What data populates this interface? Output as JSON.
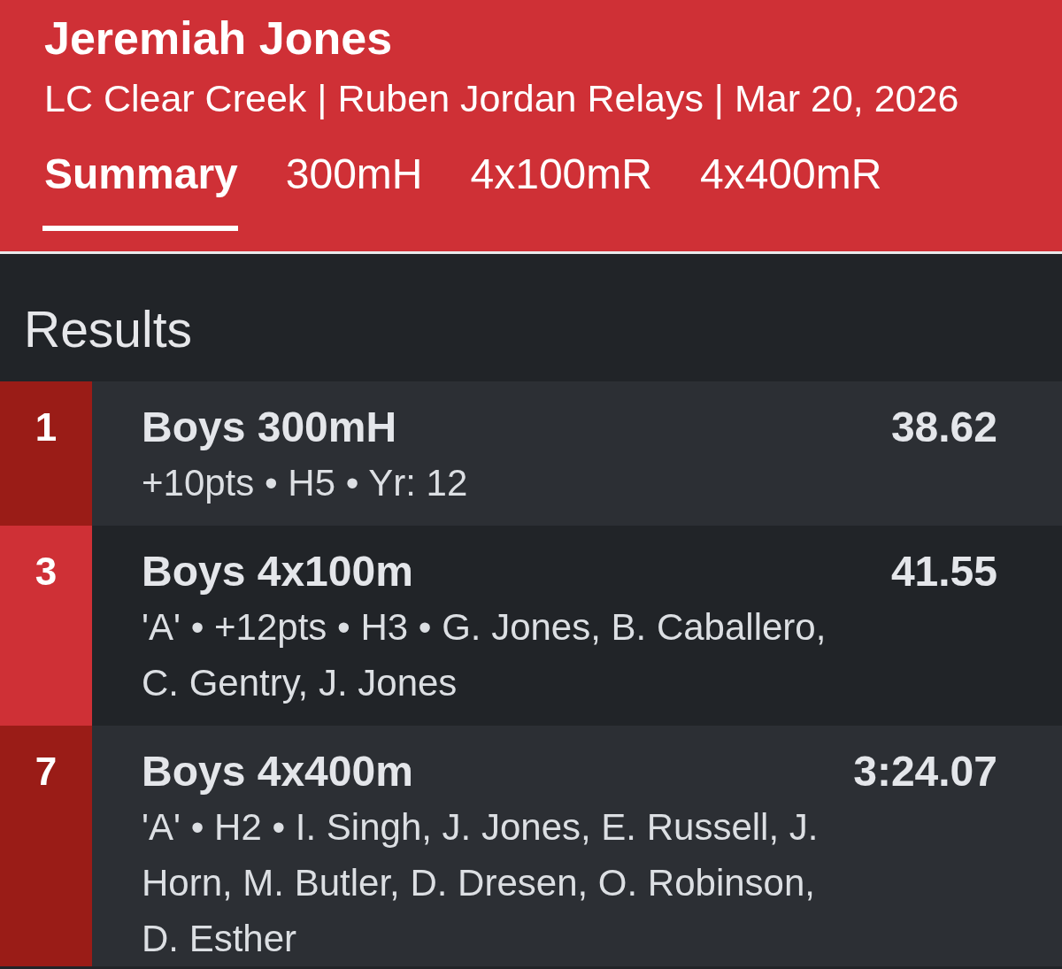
{
  "header": {
    "title": "Jeremiah Jones",
    "subtitle": "LC Clear Creek | Ruben Jordan Relays | Mar 20, 2026"
  },
  "tabs": [
    {
      "label": "Summary",
      "selected": true
    },
    {
      "label": "300mH",
      "selected": false
    },
    {
      "label": "4x100mR",
      "selected": false
    },
    {
      "label": "4x400mR",
      "selected": false
    }
  ],
  "results": {
    "heading": "Results",
    "rows": [
      {
        "place": "1",
        "event": "Boys 300mH",
        "time": "38.62",
        "details": "+10pts • H5 • Yr: 12"
      },
      {
        "place": "3",
        "event": "Boys 4x100m",
        "time": "41.55",
        "details": "'A' • +12pts • H3 • G. Jones, B. Caballero, C. Gentry, J. Jones"
      },
      {
        "place": "7",
        "event": "Boys 4x400m",
        "time": "3:24.07",
        "details": "'A' • H2 • I. Singh, J. Jones, E. Russell, J. Horn, M. Butler, D. Dresen, O. Robinson, D. Esther"
      }
    ]
  }
}
